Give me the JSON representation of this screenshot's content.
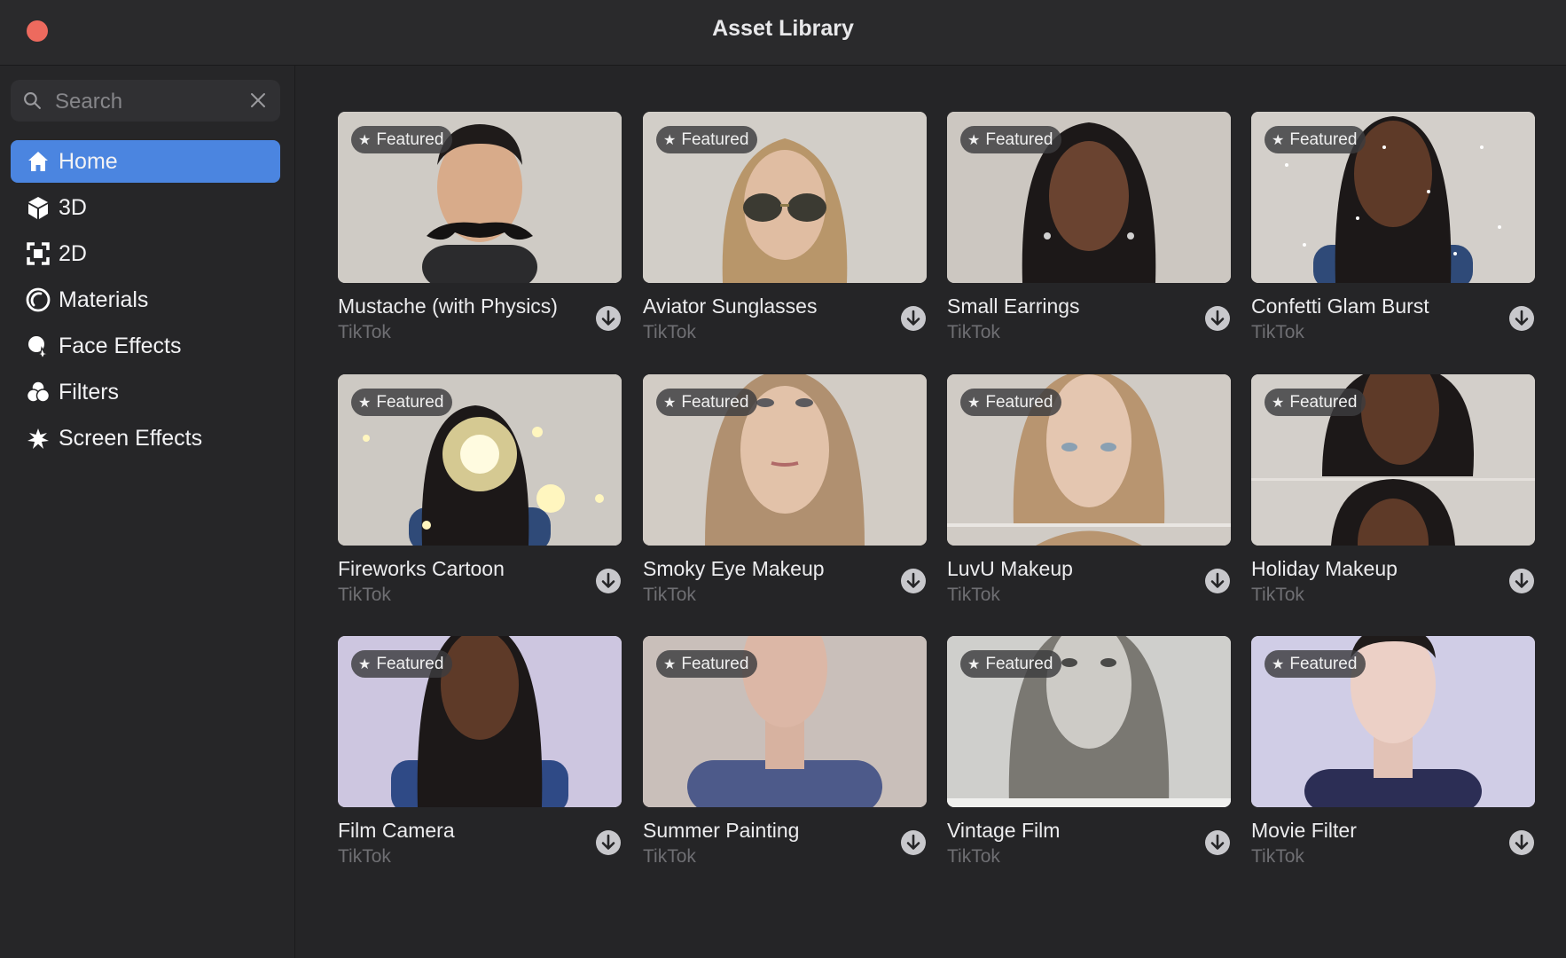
{
  "window": {
    "title": "Asset Library"
  },
  "search": {
    "placeholder": "Search"
  },
  "sidebar": {
    "items": [
      {
        "label": "Home",
        "icon": "home-icon",
        "active": true
      },
      {
        "label": "3D",
        "icon": "cube-icon",
        "active": false
      },
      {
        "label": "2D",
        "icon": "frame-icon",
        "active": false
      },
      {
        "label": "Materials",
        "icon": "materials-icon",
        "active": false
      },
      {
        "label": "Face Effects",
        "icon": "face-effects-icon",
        "active": false
      },
      {
        "label": "Filters",
        "icon": "filters-icon",
        "active": false
      },
      {
        "label": "Screen Effects",
        "icon": "screen-effects-icon",
        "active": false
      }
    ]
  },
  "grid": {
    "badge_label": "Featured",
    "cards": [
      {
        "name": "Mustache (with Physics)",
        "author": "TikTok"
      },
      {
        "name": "Aviator Sunglasses",
        "author": "TikTok"
      },
      {
        "name": "Small Earrings",
        "author": "TikTok"
      },
      {
        "name": "Confetti Glam Burst",
        "author": "TikTok"
      },
      {
        "name": "Fireworks Cartoon",
        "author": "TikTok"
      },
      {
        "name": "Smoky Eye Makeup",
        "author": "TikTok"
      },
      {
        "name": "LuvU Makeup",
        "author": "TikTok"
      },
      {
        "name": "Holiday Makeup",
        "author": "TikTok"
      },
      {
        "name": "Film Camera",
        "author": "TikTok"
      },
      {
        "name": "Summer Painting",
        "author": "TikTok"
      },
      {
        "name": "Vintage Film",
        "author": "TikTok"
      },
      {
        "name": "Movie Filter",
        "author": "TikTok"
      }
    ]
  },
  "colors": {
    "accent": "#4b85e0",
    "close": "#ed6a5e",
    "background": "#252527"
  }
}
